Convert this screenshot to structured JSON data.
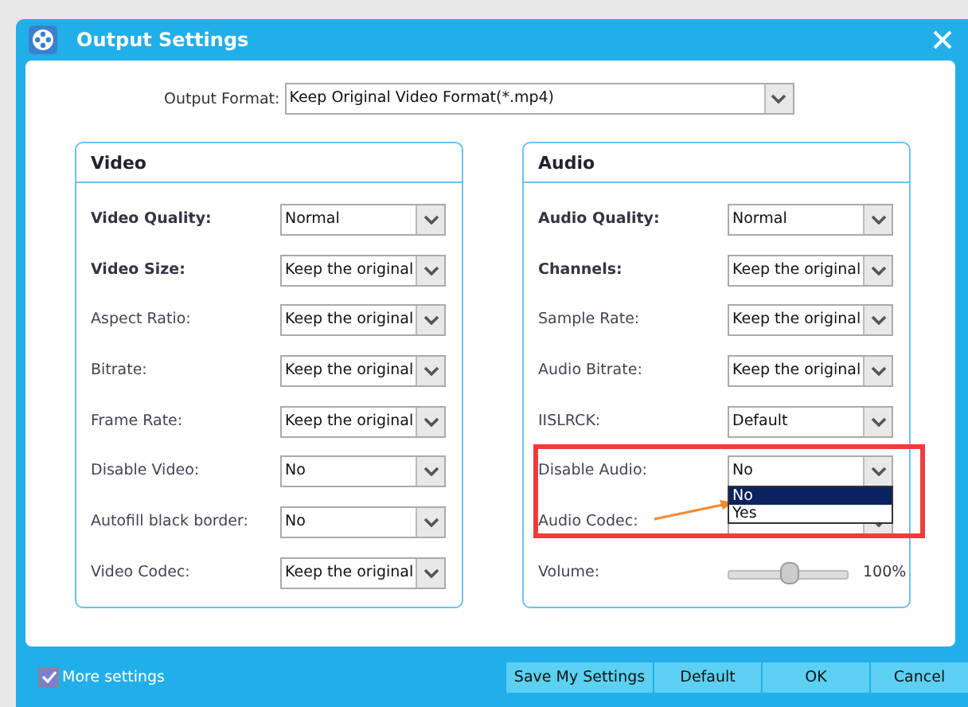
{
  "window": {
    "title": "Output Settings"
  },
  "output_format": {
    "label": "Output Format:",
    "value": "Keep Original Video Format(*.mp4)"
  },
  "panels": [
    {
      "title": "Video",
      "rows": [
        {
          "kind": "select",
          "label": "Video Quality:",
          "bold": true,
          "value": "Normal"
        },
        {
          "kind": "select",
          "label": "Video Size:",
          "bold": true,
          "value": "Keep the original"
        },
        {
          "kind": "select",
          "label": "Aspect Ratio:",
          "bold": false,
          "value": "Keep the original"
        },
        {
          "kind": "select",
          "label": "Bitrate:",
          "bold": false,
          "value": "Keep the original"
        },
        {
          "kind": "select",
          "label": "Frame Rate:",
          "bold": false,
          "value": "Keep the original"
        },
        {
          "kind": "select",
          "label": "Disable Video:",
          "bold": false,
          "value": "No"
        },
        {
          "kind": "select",
          "label": "Autofill black border:",
          "bold": false,
          "value": "No"
        },
        {
          "kind": "select",
          "label": "Video Codec:",
          "bold": false,
          "value": "Keep the original"
        }
      ]
    },
    {
      "title": "Audio",
      "rows": [
        {
          "kind": "select",
          "label": "Audio Quality:",
          "bold": true,
          "value": "Normal"
        },
        {
          "kind": "select",
          "label": "Channels:",
          "bold": true,
          "value": "Keep the original"
        },
        {
          "kind": "select",
          "label": "Sample Rate:",
          "bold": false,
          "value": "Keep the original"
        },
        {
          "kind": "select",
          "label": "Audio Bitrate:",
          "bold": false,
          "value": "Keep the original"
        },
        {
          "kind": "select",
          "label": "IISLRCK:",
          "bold": false,
          "value": "Default"
        },
        {
          "kind": "select",
          "label": "Disable Audio:",
          "bold": false,
          "value": "No",
          "options": [
            {
              "label": "No",
              "selected": true
            },
            {
              "label": "Yes",
              "selected": false
            }
          ]
        },
        {
          "kind": "select",
          "label": "Audio Codec:",
          "bold": false
        },
        {
          "kind": "slider",
          "label": "Volume:",
          "bold": false,
          "level": 0.5,
          "reading": "100%"
        }
      ]
    }
  ],
  "more_settings": {
    "label": "More settings",
    "checked": true
  },
  "buttons": [
    "Save My Settings",
    "Default",
    "OK",
    "Cancel"
  ],
  "annotation": {
    "kind": "highlight"
  }
}
